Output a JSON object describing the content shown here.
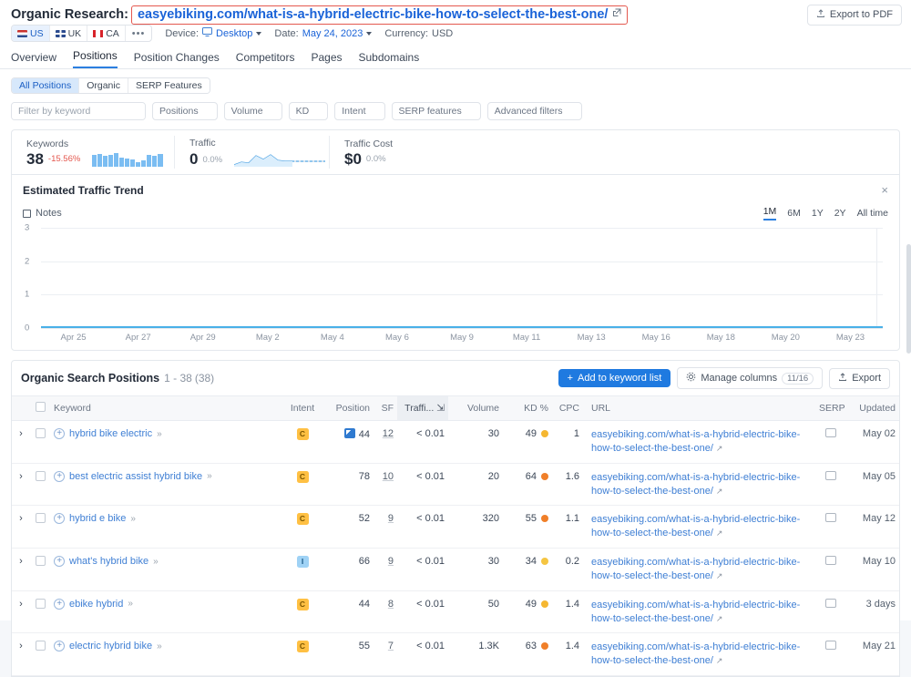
{
  "header": {
    "title_prefix": "Organic Research:",
    "url": "easyebiking.com/what-is-a-hybrid-electric-bike-how-to-select-the-best-one/",
    "external_icon": "external-link-icon",
    "export_pdf_label": "Export to PDF"
  },
  "subheader": {
    "countries": [
      {
        "code": "US",
        "label": "US",
        "active": true
      },
      {
        "code": "UK",
        "label": "UK",
        "active": false
      },
      {
        "code": "CA",
        "label": "CA",
        "active": false
      }
    ],
    "more_label": "•••",
    "device_label": "Device:",
    "device_value": "Desktop",
    "date_label": "Date:",
    "date_value": "May 24, 2023",
    "currency_label": "Currency:",
    "currency_value": "USD"
  },
  "tabs": [
    {
      "label": "Overview",
      "active": false
    },
    {
      "label": "Positions",
      "active": true
    },
    {
      "label": "Position Changes",
      "active": false
    },
    {
      "label": "Competitors",
      "active": false
    },
    {
      "label": "Pages",
      "active": false
    },
    {
      "label": "Subdomains",
      "active": false
    }
  ],
  "position_pills": [
    {
      "label": "All Positions",
      "active": true
    },
    {
      "label": "Organic",
      "active": false
    },
    {
      "label": "SERP Features",
      "active": false
    }
  ],
  "filters": {
    "search_placeholder": "Filter by keyword",
    "search_value": "",
    "dropdowns": [
      "Positions",
      "Volume",
      "KD",
      "Intent",
      "SERP features",
      "Advanced filters"
    ]
  },
  "kpis": [
    {
      "label": "Keywords",
      "value": "38",
      "delta": "-15.56%",
      "delta_type": "neg",
      "spark": "bars"
    },
    {
      "label": "Traffic",
      "value": "0",
      "delta": "0.0%",
      "delta_type": "zero",
      "spark": "line"
    },
    {
      "label": "Traffic Cost",
      "value": "$0",
      "delta": "0.0%",
      "delta_type": "zero",
      "spark": "none"
    }
  ],
  "chart_panel": {
    "title": "Estimated Traffic Trend",
    "close_icon": "close-icon",
    "notes_label": "Notes",
    "ranges": [
      {
        "label": "1M",
        "active": true
      },
      {
        "label": "6M",
        "active": false
      },
      {
        "label": "1Y",
        "active": false
      },
      {
        "label": "2Y",
        "active": false
      },
      {
        "label": "All time",
        "active": false
      }
    ]
  },
  "chart_data": {
    "type": "line",
    "title": "Estimated Traffic Trend",
    "xlabel": "",
    "ylabel": "",
    "grid": true,
    "legend_position": "none",
    "ylim": [
      0,
      3
    ],
    "yticks": [
      0,
      1,
      2,
      3
    ],
    "x": [
      "Apr 25",
      "Apr 27",
      "Apr 29",
      "May 2",
      "May 4",
      "May 6",
      "May 9",
      "May 11",
      "May 13",
      "May 16",
      "May 18",
      "May 20",
      "May 23"
    ],
    "series": [
      {
        "name": "Estimated Traffic",
        "color": "#49b0e8",
        "values": [
          0,
          0,
          0,
          0,
          0,
          0,
          0,
          0,
          0,
          0,
          0,
          0,
          0
        ]
      }
    ]
  },
  "table": {
    "title": "Organic Search Positions",
    "range": "1 - 38",
    "total": "(38)",
    "add_to_list_label": "Add to keyword list",
    "manage_columns_label": "Manage columns",
    "manage_columns_badge": "11/16",
    "export_label": "Export",
    "columns": [
      {
        "key": "expand",
        "label": ""
      },
      {
        "key": "check",
        "label": ""
      },
      {
        "key": "keyword",
        "label": "Keyword"
      },
      {
        "key": "intent",
        "label": "Intent"
      },
      {
        "key": "position",
        "label": "Position"
      },
      {
        "key": "sf",
        "label": "SF"
      },
      {
        "key": "traffic",
        "label": "Traffi...",
        "sorted": true
      },
      {
        "key": "volume",
        "label": "Volume"
      },
      {
        "key": "kd",
        "label": "KD %"
      },
      {
        "key": "cpc",
        "label": "CPC"
      },
      {
        "key": "url",
        "label": "URL"
      },
      {
        "key": "serp",
        "label": "SERP"
      },
      {
        "key": "updated",
        "label": "Updated"
      }
    ],
    "rows": [
      {
        "keyword": "hybrid bike electric",
        "intent": "C",
        "position": "44",
        "has_sf_icon": true,
        "sf": "12",
        "traffic": "< 0.01",
        "volume": "30",
        "kd": "49",
        "kd_color": "#f5b731",
        "cpc": "1",
        "url": "easyebiking.com/what-is-a-hybrid-electric-bike-how-to-select-the-best-one/",
        "updated": "May 02"
      },
      {
        "keyword": "best electric assist hybrid bike",
        "intent": "C",
        "position": "78",
        "has_sf_icon": false,
        "sf": "10",
        "traffic": "< 0.01",
        "volume": "20",
        "kd": "64",
        "kd_color": "#f07f29",
        "cpc": "1.6",
        "url": "easyebiking.com/what-is-a-hybrid-electric-bike-how-to-select-the-best-one/",
        "updated": "May 05"
      },
      {
        "keyword": "hybrid e bike",
        "intent": "C",
        "position": "52",
        "has_sf_icon": false,
        "sf": "9",
        "traffic": "< 0.01",
        "volume": "320",
        "kd": "55",
        "kd_color": "#f07f29",
        "cpc": "1.1",
        "url": "easyebiking.com/what-is-a-hybrid-electric-bike-how-to-select-the-best-one/",
        "updated": "May 12"
      },
      {
        "keyword": "what's hybrid bike",
        "intent": "I",
        "position": "66",
        "has_sf_icon": false,
        "sf": "9",
        "traffic": "< 0.01",
        "volume": "30",
        "kd": "34",
        "kd_color": "#f5c542",
        "cpc": "0.2",
        "url": "easyebiking.com/what-is-a-hybrid-electric-bike-how-to-select-the-best-one/",
        "updated": "May 10"
      },
      {
        "keyword": "ebike hybrid",
        "intent": "C",
        "position": "44",
        "has_sf_icon": false,
        "sf": "8",
        "traffic": "< 0.01",
        "volume": "50",
        "kd": "49",
        "kd_color": "#f5b731",
        "cpc": "1.4",
        "url": "easyebiking.com/what-is-a-hybrid-electric-bike-how-to-select-the-best-one/",
        "updated": "3 days"
      },
      {
        "keyword": "electric hybrid bike",
        "intent": "C",
        "position": "55",
        "has_sf_icon": false,
        "sf": "7",
        "traffic": "< 0.01",
        "volume": "1.3K",
        "kd": "63",
        "kd_color": "#f07f29",
        "cpc": "1.4",
        "url": "easyebiking.com/what-is-a-hybrid-electric-bike-how-to-select-the-best-one/",
        "updated": "May 21"
      }
    ]
  },
  "colors": {
    "accent_blue": "#1f7ae0",
    "link_blue": "#3f7fd4",
    "highlight_red": "#e4584f",
    "chart_line": "#49b0e8"
  }
}
